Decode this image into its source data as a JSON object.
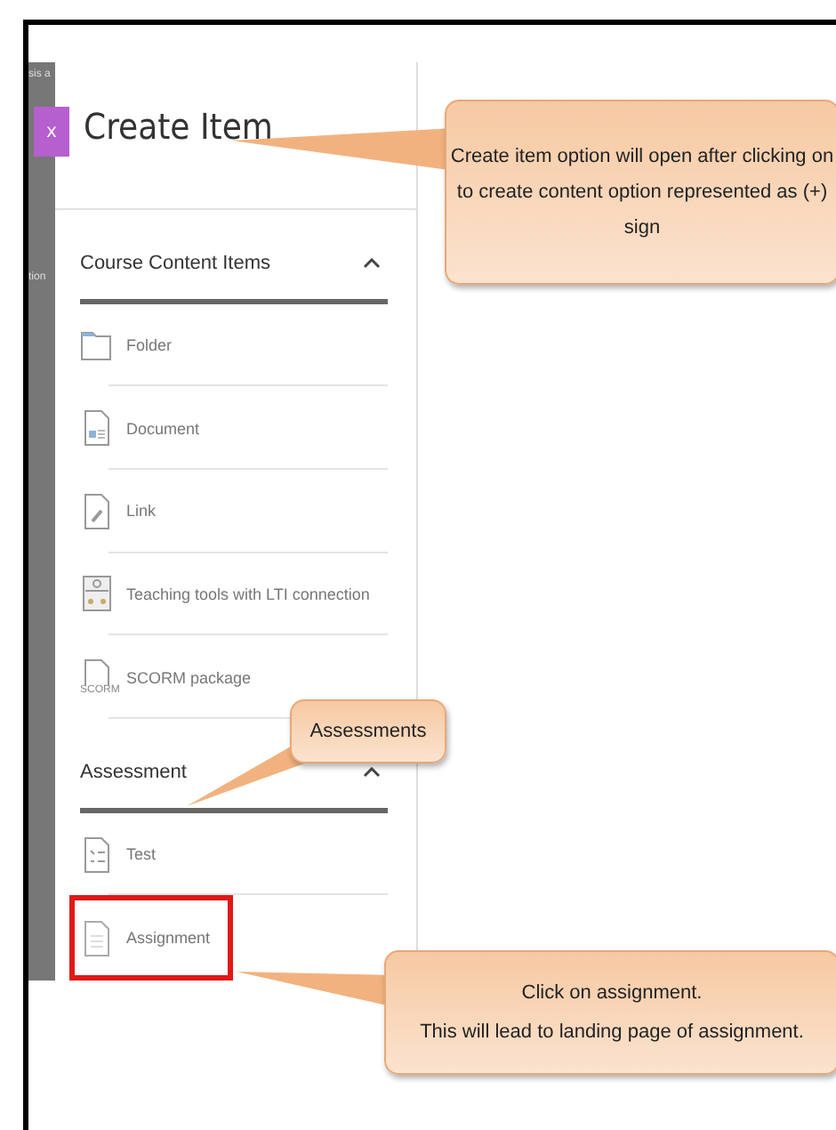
{
  "backdrop": {
    "fragments": [
      "sis a",
      "tion"
    ]
  },
  "panel": {
    "close_label": "x",
    "title": "Create Item",
    "sections": [
      {
        "title": "Course Content Items",
        "expanded": true,
        "items": [
          {
            "label": "Folder",
            "kind": "folder",
            "highlighted": false
          },
          {
            "label": "Document",
            "kind": "document",
            "highlighted": false
          },
          {
            "label": "Link",
            "kind": "link",
            "highlighted": false
          },
          {
            "label": "Teaching tools with LTI connection",
            "kind": "lti",
            "highlighted": false
          },
          {
            "label": "SCORM package",
            "kind": "scorm",
            "icon_text": "SCORM",
            "highlighted": false
          }
        ]
      },
      {
        "title": "Assessment",
        "expanded": true,
        "items": [
          {
            "label": "Test",
            "kind": "test",
            "highlighted": false
          },
          {
            "label": "Assignment",
            "kind": "assignment",
            "highlighted": true
          }
        ]
      }
    ]
  },
  "callouts": [
    {
      "lines": [
        "Create item option will open after clicking on to create content option represented as (+) sign"
      ]
    },
    {
      "lines": [
        "Assessments"
      ]
    },
    {
      "lines": [
        "Click on assignment.",
        "This will lead to landing page of assignment."
      ]
    }
  ]
}
